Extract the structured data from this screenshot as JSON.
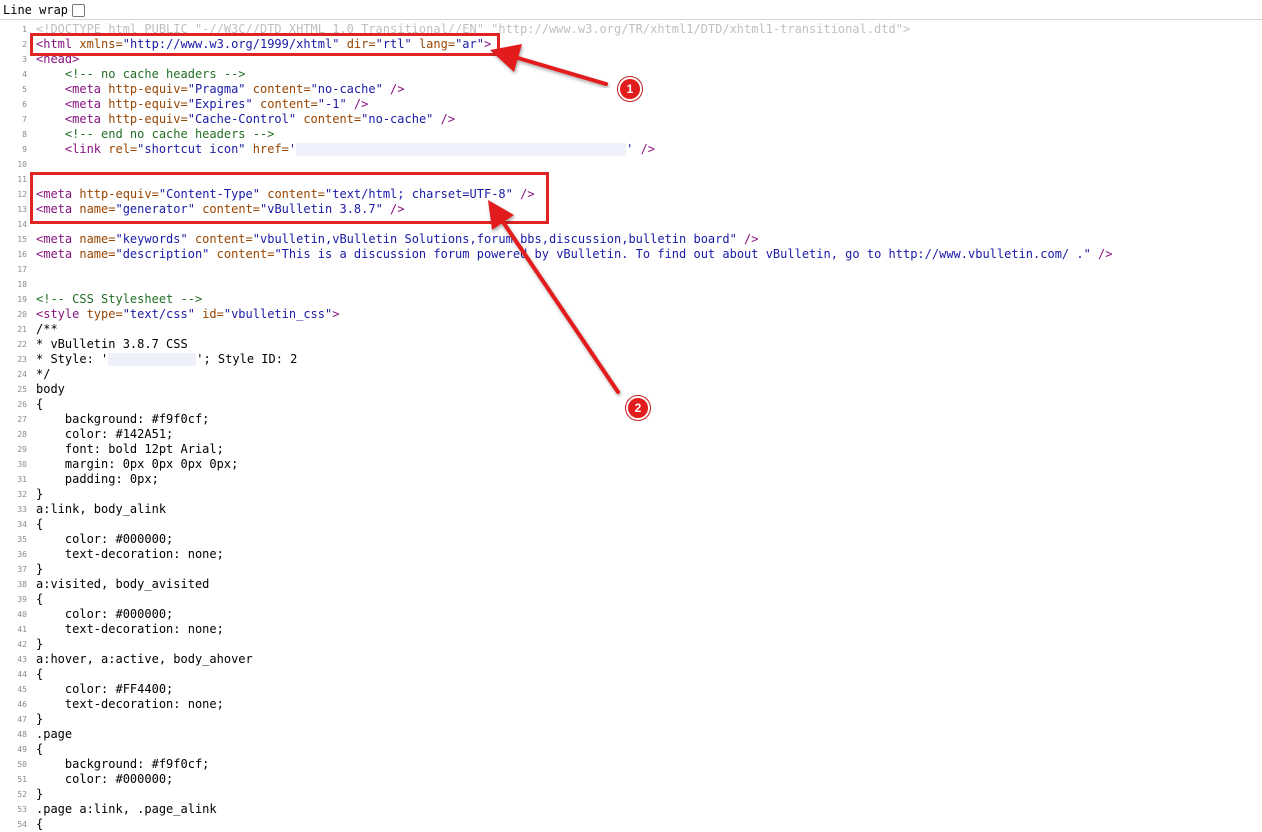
{
  "toolbar": {
    "line_wrap_label": "Line wrap",
    "line_wrap_checked": false
  },
  "annotations": [
    {
      "number": "1"
    },
    {
      "number": "2"
    }
  ],
  "colors": {
    "annotation_red": "#e02424",
    "tag": "#881280",
    "attribute": "#994500",
    "value": "#1a1aa6",
    "comment": "#236e25"
  },
  "lines": [
    {
      "n": "1",
      "segs": [
        {
          "t": "<!DOCTYPE html PUBLIC \"-//W3C//DTD XHTML 1.0 Transitional//EN\" \"http://www.w3.org/TR/xhtml1/DTD/xhtml1-transitional.dtd\">",
          "c": "doctype"
        }
      ]
    },
    {
      "n": "2",
      "segs": [
        {
          "t": "<html ",
          "c": "tag"
        },
        {
          "t": "xmlns=",
          "c": "attr"
        },
        {
          "t": "\"http://www.w3.org/1999/xhtml\"",
          "c": "val"
        },
        {
          "t": " dir=",
          "c": "attr"
        },
        {
          "t": "\"rtl\"",
          "c": "val"
        },
        {
          "t": " lang=",
          "c": "attr"
        },
        {
          "t": "\"ar\"",
          "c": "val"
        },
        {
          "t": ">",
          "c": "tag"
        }
      ]
    },
    {
      "n": "3",
      "segs": [
        {
          "t": "<head>",
          "c": "tag"
        }
      ]
    },
    {
      "n": "4",
      "segs": [
        {
          "t": "    <!-- no cache headers -->",
          "c": "comment"
        }
      ]
    },
    {
      "n": "5",
      "segs": [
        {
          "t": "    <meta ",
          "c": "tag"
        },
        {
          "t": "http-equiv=",
          "c": "attr"
        },
        {
          "t": "\"Pragma\"",
          "c": "val"
        },
        {
          "t": " content=",
          "c": "attr"
        },
        {
          "t": "\"no-cache\"",
          "c": "val"
        },
        {
          "t": " />",
          "c": "tag"
        }
      ]
    },
    {
      "n": "6",
      "segs": [
        {
          "t": "    <meta ",
          "c": "tag"
        },
        {
          "t": "http-equiv=",
          "c": "attr"
        },
        {
          "t": "\"Expires\"",
          "c": "val"
        },
        {
          "t": " content=",
          "c": "attr"
        },
        {
          "t": "\"-1\"",
          "c": "val"
        },
        {
          "t": " />",
          "c": "tag"
        }
      ]
    },
    {
      "n": "7",
      "segs": [
        {
          "t": "    <meta ",
          "c": "tag"
        },
        {
          "t": "http-equiv=",
          "c": "attr"
        },
        {
          "t": "\"Cache-Control\"",
          "c": "val"
        },
        {
          "t": " content=",
          "c": "attr"
        },
        {
          "t": "\"no-cache\"",
          "c": "val"
        },
        {
          "t": " />",
          "c": "tag"
        }
      ]
    },
    {
      "n": "8",
      "segs": [
        {
          "t": "    <!-- end no cache headers -->",
          "c": "comment"
        }
      ]
    },
    {
      "n": "9",
      "segs": [
        {
          "t": "    <link ",
          "c": "tag"
        },
        {
          "t": "rel=",
          "c": "attr"
        },
        {
          "t": "\"shortcut icon\"",
          "c": "val"
        },
        {
          "t": " href=",
          "c": "attr"
        },
        {
          "t": "'",
          "c": "val"
        },
        {
          "blur": "wide"
        },
        {
          "t": "'",
          "c": "val"
        },
        {
          "t": " />",
          "c": "tag"
        }
      ]
    },
    {
      "n": "10",
      "segs": []
    },
    {
      "n": "11",
      "segs": []
    },
    {
      "n": "12",
      "segs": [
        {
          "t": "<meta ",
          "c": "tag"
        },
        {
          "t": "http-equiv=",
          "c": "attr"
        },
        {
          "t": "\"Content-Type\"",
          "c": "val"
        },
        {
          "t": " content=",
          "c": "attr"
        },
        {
          "t": "\"text/html; charset=UTF-8\"",
          "c": "val"
        },
        {
          "t": " />",
          "c": "tag"
        }
      ]
    },
    {
      "n": "13",
      "segs": [
        {
          "t": "<meta ",
          "c": "tag"
        },
        {
          "t": "name=",
          "c": "attr"
        },
        {
          "t": "\"generator\"",
          "c": "val"
        },
        {
          "t": " content=",
          "c": "attr"
        },
        {
          "t": "\"vBulletin 3.8.7\"",
          "c": "val"
        },
        {
          "t": " />",
          "c": "tag"
        }
      ]
    },
    {
      "n": "14",
      "segs": []
    },
    {
      "n": "15",
      "segs": [
        {
          "t": "<meta ",
          "c": "tag"
        },
        {
          "t": "name=",
          "c": "attr"
        },
        {
          "t": "\"keywords\"",
          "c": "val"
        },
        {
          "t": " content=",
          "c": "attr"
        },
        {
          "t": "\"vbulletin,vBulletin Solutions,forum,bbs,discussion,bulletin board\"",
          "c": "val"
        },
        {
          "t": " />",
          "c": "tag"
        }
      ]
    },
    {
      "n": "16",
      "segs": [
        {
          "t": "<meta ",
          "c": "tag"
        },
        {
          "t": "name=",
          "c": "attr"
        },
        {
          "t": "\"description\"",
          "c": "val"
        },
        {
          "t": " content=",
          "c": "attr"
        },
        {
          "t": "\"This is a discussion forum powered by vBulletin. To find out about vBulletin, go to http://www.vbulletin.com/ .\"",
          "c": "val"
        },
        {
          "t": " />",
          "c": "tag"
        }
      ]
    },
    {
      "n": "17",
      "segs": []
    },
    {
      "n": "18",
      "segs": []
    },
    {
      "n": "19",
      "segs": [
        {
          "t": "<!-- CSS Stylesheet -->",
          "c": "comment"
        }
      ]
    },
    {
      "n": "20",
      "segs": [
        {
          "t": "<style ",
          "c": "tag"
        },
        {
          "t": "type=",
          "c": "attr"
        },
        {
          "t": "\"text/css\"",
          "c": "val"
        },
        {
          "t": " id=",
          "c": "attr"
        },
        {
          "t": "\"vbulletin_css\"",
          "c": "val"
        },
        {
          "t": ">",
          "c": "tag"
        }
      ]
    },
    {
      "n": "21",
      "segs": [
        {
          "t": "/**"
        }
      ]
    },
    {
      "n": "22",
      "segs": [
        {
          "t": "* vBulletin 3.8.7 CSS"
        }
      ]
    },
    {
      "n": "23",
      "segs": [
        {
          "t": "* Style: '"
        },
        {
          "blur": "short"
        },
        {
          "t": "'; Style ID: 2"
        }
      ]
    },
    {
      "n": "24",
      "segs": [
        {
          "t": "*/"
        }
      ]
    },
    {
      "n": "25",
      "segs": [
        {
          "t": "body"
        }
      ]
    },
    {
      "n": "26",
      "segs": [
        {
          "t": "{"
        }
      ]
    },
    {
      "n": "27",
      "segs": [
        {
          "t": "    background: #f9f0cf;"
        }
      ]
    },
    {
      "n": "28",
      "segs": [
        {
          "t": "    color: #142A51;"
        }
      ]
    },
    {
      "n": "29",
      "segs": [
        {
          "t": "    font: bold 12pt Arial;"
        }
      ]
    },
    {
      "n": "30",
      "segs": [
        {
          "t": "    margin: 0px 0px 0px 0px;"
        }
      ]
    },
    {
      "n": "31",
      "segs": [
        {
          "t": "    padding: 0px;"
        }
      ]
    },
    {
      "n": "32",
      "segs": [
        {
          "t": "}"
        }
      ]
    },
    {
      "n": "33",
      "segs": [
        {
          "t": "a:link, body_alink"
        }
      ]
    },
    {
      "n": "34",
      "segs": [
        {
          "t": "{"
        }
      ]
    },
    {
      "n": "35",
      "segs": [
        {
          "t": "    color: #000000;"
        }
      ]
    },
    {
      "n": "36",
      "segs": [
        {
          "t": "    text-decoration: none;"
        }
      ]
    },
    {
      "n": "37",
      "segs": [
        {
          "t": "}"
        }
      ]
    },
    {
      "n": "38",
      "segs": [
        {
          "t": "a:visited, body_avisited"
        }
      ]
    },
    {
      "n": "39",
      "segs": [
        {
          "t": "{"
        }
      ]
    },
    {
      "n": "40",
      "segs": [
        {
          "t": "    color: #000000;"
        }
      ]
    },
    {
      "n": "41",
      "segs": [
        {
          "t": "    text-decoration: none;"
        }
      ]
    },
    {
      "n": "42",
      "segs": [
        {
          "t": "}"
        }
      ]
    },
    {
      "n": "43",
      "segs": [
        {
          "t": "a:hover, a:active, body_ahover"
        }
      ]
    },
    {
      "n": "44",
      "segs": [
        {
          "t": "{"
        }
      ]
    },
    {
      "n": "45",
      "segs": [
        {
          "t": "    color: #FF4400;"
        }
      ]
    },
    {
      "n": "46",
      "segs": [
        {
          "t": "    text-decoration: none;"
        }
      ]
    },
    {
      "n": "47",
      "segs": [
        {
          "t": "}"
        }
      ]
    },
    {
      "n": "48",
      "segs": [
        {
          "t": ".page"
        }
      ]
    },
    {
      "n": "49",
      "segs": [
        {
          "t": "{"
        }
      ]
    },
    {
      "n": "50",
      "segs": [
        {
          "t": "    background: #f9f0cf;"
        }
      ]
    },
    {
      "n": "51",
      "segs": [
        {
          "t": "    color: #000000;"
        }
      ]
    },
    {
      "n": "52",
      "segs": [
        {
          "t": "}"
        }
      ]
    },
    {
      "n": "53",
      "segs": [
        {
          "t": ".page a:link, .page_alink"
        }
      ]
    },
    {
      "n": "54",
      "segs": [
        {
          "t": "{"
        }
      ]
    }
  ]
}
